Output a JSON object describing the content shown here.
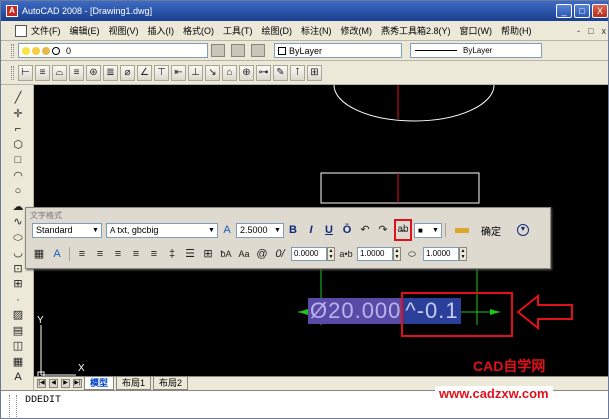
{
  "window": {
    "title": "AutoCAD 2008 - [Drawing1.dwg]",
    "controls": [
      "_",
      "□",
      "X"
    ]
  },
  "menu": {
    "items": [
      "文件(F)",
      "编辑(E)",
      "视图(V)",
      "插入(I)",
      "格式(O)",
      "工具(T)",
      "绘图(D)",
      "标注(N)",
      "修改(M)",
      "燕秀工具箱2.8(Y)",
      "窗口(W)",
      "帮助(H)"
    ],
    "doc_controls": [
      "-",
      "□",
      "x"
    ]
  },
  "layer_toolbar": {
    "layer_value": "0",
    "color_value": "ByLayer",
    "linetype_value": "ByLayer"
  },
  "dim_toolbar": {
    "icons": [
      "linear-dim",
      "aligned-dim",
      "arc-length",
      "ordinate",
      "radius",
      "jogged",
      "diameter",
      "angular",
      "quick-dim",
      "baseline",
      "continue",
      "leader",
      "tolerance",
      "center-mark",
      "dim-edit",
      "dim-text-edit",
      "dim-update",
      "dim-style"
    ]
  },
  "text_formatting": {
    "title": "文字格式",
    "style_value": "Standard",
    "font_value": "txt, gbcbig",
    "height_value": "2.5000",
    "buttons": [
      "B",
      "I",
      "U",
      "Ō",
      "↶",
      "↷",
      "stack"
    ],
    "color_value": "■",
    "confirm_label": "确定",
    "oblique_value": "0.0000",
    "tracking_value": "1.0000",
    "width_factor_value": "1.0000"
  },
  "drawing": {
    "dim_text_prefix": "Ø20.000",
    "dim_text_suffix": "^-0.1",
    "ucs_x_label": "X",
    "ucs_y_label": "Y"
  },
  "tabs": {
    "items": [
      "模型",
      "布局1",
      "布局2"
    ],
    "active_index": 0
  },
  "command": {
    "text": "DDEDIT"
  },
  "watermark": {
    "line1": "CAD自学网",
    "line2": "www.cadzxw.com"
  },
  "colors": {
    "title_bar": "#1a3f8f",
    "drawing_bg": "#000000",
    "highlight_red": "#e0101a",
    "dim_text_bg": "#5a4aa8",
    "selection_bg": "#2a3f9a",
    "green_lines": "#22c31f"
  }
}
